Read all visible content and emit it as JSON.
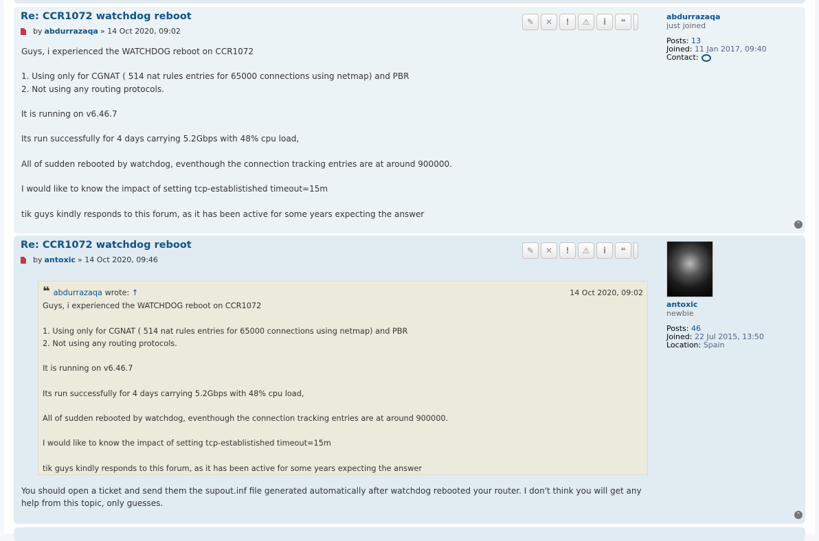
{
  "posts": [
    {
      "title": "Re: CCR1072 watchdog reboot",
      "by_label": "by",
      "author": "abdurrazaqa",
      "date_sep": "»",
      "date": "14 Oct 2020, 09:02",
      "content": [
        "Guys, i experienced the WATCHDOG reboot on CCR1072",
        "",
        "1. Using only for CGNAT ( 514 nat rules entries for 65000 connections using netmap) and PBR",
        "2. Not using any routing protocols.",
        "",
        "It is running on v6.46.7",
        "",
        "Its run successfully for 4 days carrying 5.2Gbps with 48% cpu load,",
        "",
        "All of sudden rebooted by watchdog, eventhough the connection tracking entries are at around 900000.",
        "",
        "I would like to know the impact of setting tcp-establistished timeout=15m",
        "",
        "tik guys kindly responds to this forum, as it has been active for some years expecting the answer"
      ],
      "profile": {
        "username": "abdurrazaqa",
        "rank": "just joined",
        "posts_label": "Posts:",
        "posts": "13",
        "joined_label": "Joined:",
        "joined": "11 Jan 2017, 09:40",
        "contact_label": "Contact:"
      }
    },
    {
      "title": "Re: CCR1072 watchdog reboot",
      "by_label": "by",
      "author": "antoxic",
      "date_sep": "»",
      "date": "14 Oct 2020, 09:46",
      "quote": {
        "author": "abdurrazaqa",
        "wrote": "wrote:",
        "arrow": "↑",
        "date": "14 Oct 2020, 09:02",
        "content": [
          "Guys, i experienced the WATCHDOG reboot on CCR1072",
          "",
          "1. Using only for CGNAT ( 514 nat rules entries for 65000 connections using netmap) and PBR",
          "2. Not using any routing protocols.",
          "",
          "It is running on v6.46.7",
          "",
          "Its run successfully for 4 days carrying 5.2Gbps with 48% cpu load,",
          "",
          "All of sudden rebooted by watchdog, eventhough the connection tracking entries are at around 900000.",
          "",
          "I would like to know the impact of setting tcp-establistished timeout=15m",
          "",
          "tik guys kindly responds to this forum, as it has been active for some years expecting the answer"
        ]
      },
      "reply": "You should open a ticket and send them the supout.inf file generated automatically after watchdog rebooted your router. I don't think you will get any help from this topic, only guesses.",
      "profile": {
        "username": "antoxic",
        "rank": "newbie",
        "posts_label": "Posts:",
        "posts": "46",
        "joined_label": "Joined:",
        "joined": "22 Jul 2015, 13:50",
        "location_label": "Location:",
        "location": "Spain"
      }
    }
  ],
  "buttons": [
    {
      "icon": "pencil-icon",
      "glyph": "✎"
    },
    {
      "icon": "delete-icon",
      "glyph": "✕"
    },
    {
      "icon": "report-icon",
      "glyph": "!"
    },
    {
      "icon": "warning-icon",
      "glyph": "⚠"
    },
    {
      "icon": "info-icon",
      "glyph": "i"
    },
    {
      "icon": "quote-icon",
      "glyph": "❝"
    }
  ],
  "top_icon": "⌃"
}
